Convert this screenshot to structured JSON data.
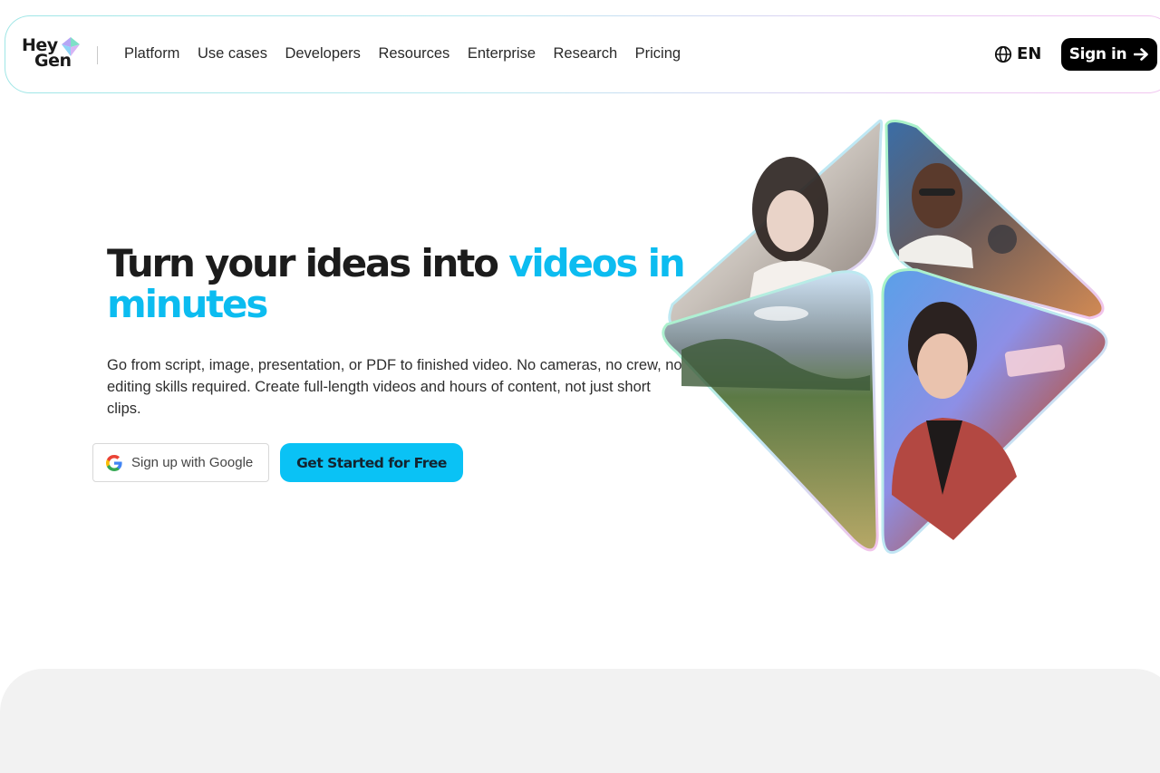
{
  "brand": {
    "logo_line1": "Hey",
    "logo_line2": "Gen"
  },
  "nav": {
    "links": [
      "Platform",
      "Use cases",
      "Developers",
      "Resources",
      "Enterprise",
      "Research",
      "Pricing"
    ],
    "language": "EN",
    "language_icon": "globe-icon",
    "signin_label": "Sign in",
    "signin_icon": "arrow-right-icon"
  },
  "hero": {
    "title_plain": "Turn your ideas into ",
    "title_accent": "videos in minutes",
    "subtitle": "Go from script, image, presentation, or PDF to finished video. No cameras, no crew, no editing skills required. Create full-length videos and hours of content, not just short clips.",
    "google_button": "Sign up with Google",
    "google_icon": "google-icon",
    "cta_button": "Get Started for Free",
    "visual_panels": [
      "woman-portrait",
      "man-with-glasses-portrait",
      "landscape-meadow",
      "man-talking-portrait"
    ]
  },
  "colors": {
    "accent": "#0cbcf0",
    "cta_background": "#0ac2f5",
    "signin_background": "#000000",
    "bottom_panel": "#f2f2f2"
  }
}
